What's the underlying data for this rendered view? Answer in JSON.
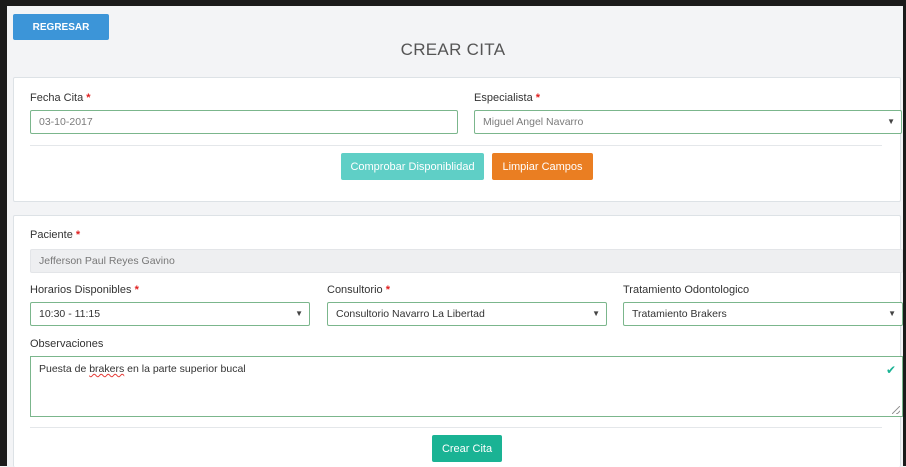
{
  "header": {
    "back_label": "REGRESAR",
    "title": "CREAR CITA"
  },
  "appointment": {
    "date_label": "Fecha Cita",
    "date_value": "03-10-2017",
    "specialist_label": "Especialista",
    "specialist_value": "Miguel Angel Navarro",
    "check_button": "Comprobar Disponiblidad",
    "clear_button": "Limpiar Campos"
  },
  "patient": {
    "patient_label": "Paciente",
    "patient_value": "Jefferson Paul Reyes Gavino",
    "hours_label": "Horarios Disponibles",
    "hours_value": "10:30 - 11:15",
    "office_label": "Consultorio",
    "office_value": "Consultorio Navarro La Libertad",
    "treatment_label": "Tratamiento Odontologico",
    "treatment_value": "Tratamiento Brakers",
    "notes_label": "Observaciones",
    "notes_before": "Puesta de ",
    "notes_misspelled": "brakers",
    "notes_after": " en la parte superior bucal",
    "submit_button": "Crear Cita"
  },
  "required_marker": "*",
  "icons": {
    "select_arrow": "dropdown-arrow-icon",
    "valid": "check-icon",
    "resize": "resize-handle-icon"
  },
  "colors": {
    "primary": "#3c95d8",
    "cyan": "#5fcfc6",
    "orange": "#ea7e22",
    "success": "#1ab394",
    "required": "#e02020"
  }
}
